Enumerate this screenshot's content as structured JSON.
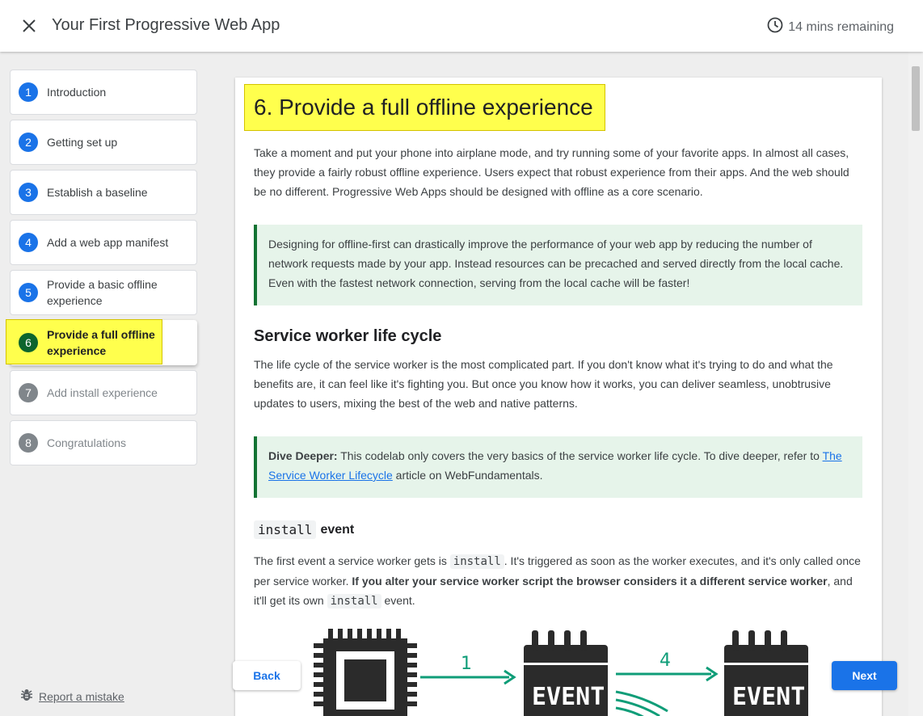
{
  "header": {
    "title": "Your First Progressive Web App",
    "time_remaining": "14 mins remaining",
    "close_icon": "close-icon",
    "clock_icon": "clock-icon"
  },
  "sidebar": {
    "steps": [
      {
        "num": "1",
        "label": "Introduction",
        "state": "done"
      },
      {
        "num": "2",
        "label": "Getting set up",
        "state": "done"
      },
      {
        "num": "3",
        "label": "Establish a baseline",
        "state": "done"
      },
      {
        "num": "4",
        "label": "Add a web app manifest",
        "state": "done"
      },
      {
        "num": "5",
        "label": "Provide a basic offline experience",
        "state": "done"
      },
      {
        "num": "6",
        "label": "Provide a full offline experience",
        "state": "active"
      },
      {
        "num": "7",
        "label": "Add install experience",
        "state": "future"
      },
      {
        "num": "8",
        "label": "Congratulations",
        "state": "future"
      }
    ],
    "report_mistake": "Report a mistake",
    "bug_icon": "bug-icon"
  },
  "content": {
    "title": "6. Provide a full offline experience",
    "intro": "Take a moment and put your phone into airplane mode, and try running some of your favorite apps. In almost all cases, they provide a fairly robust offline experience. Users expect that robust experience from their apps. And the web should be no different. Progressive Web Apps should be designed with offline as a core scenario.",
    "callout1": "Designing for offline-first can drastically improve the performance of your web app by reducing the number of network requests made by your app. Instead resources can be precached and served directly from the local cache. Even with the fastest network connection, serving from the local cache will be faster!",
    "section_heading": "Service worker life cycle",
    "lifecycle_para": "The life cycle of the service worker is the most complicated part. If you don't know what it's trying to do and what the benefits are, it can feel like it's fighting you. But once you know how it works, you can deliver seamless, unobtrusive updates to users, mixing the best of the web and native patterns.",
    "callout2": {
      "bold": "Dive Deeper:",
      "text_before": " This codelab only covers the very basics of the service worker life cycle. To dive deeper, refer to ",
      "link": "The Service Worker Lifecycle",
      "text_after": " article on WebFundamentals."
    },
    "install_heading": {
      "code": "install",
      "text": "event"
    },
    "install_para": {
      "p1": "The first event a service worker gets is ",
      "code1": "install",
      "p2": ". It's triggered as soon as the worker executes, and it's only called once per service worker. ",
      "bold": "If you alter your service worker script the browser considers it a different service worker",
      "p3": ", and it'll get its own ",
      "code2": "install",
      "p4": " event."
    },
    "diagram": {
      "arrow1_label": "1",
      "arrow2_label": "4",
      "event_label_1": "EVENT",
      "event_label_2": "EVENT",
      "accent_color": "#0f9d78"
    }
  },
  "nav": {
    "back": "Back",
    "next": "Next"
  },
  "colors": {
    "primary": "#1a73e8",
    "highlight": "#ffff4d",
    "callout_bg": "#e6f4ea",
    "callout_border": "#137333",
    "active_step": "#0d652d"
  }
}
